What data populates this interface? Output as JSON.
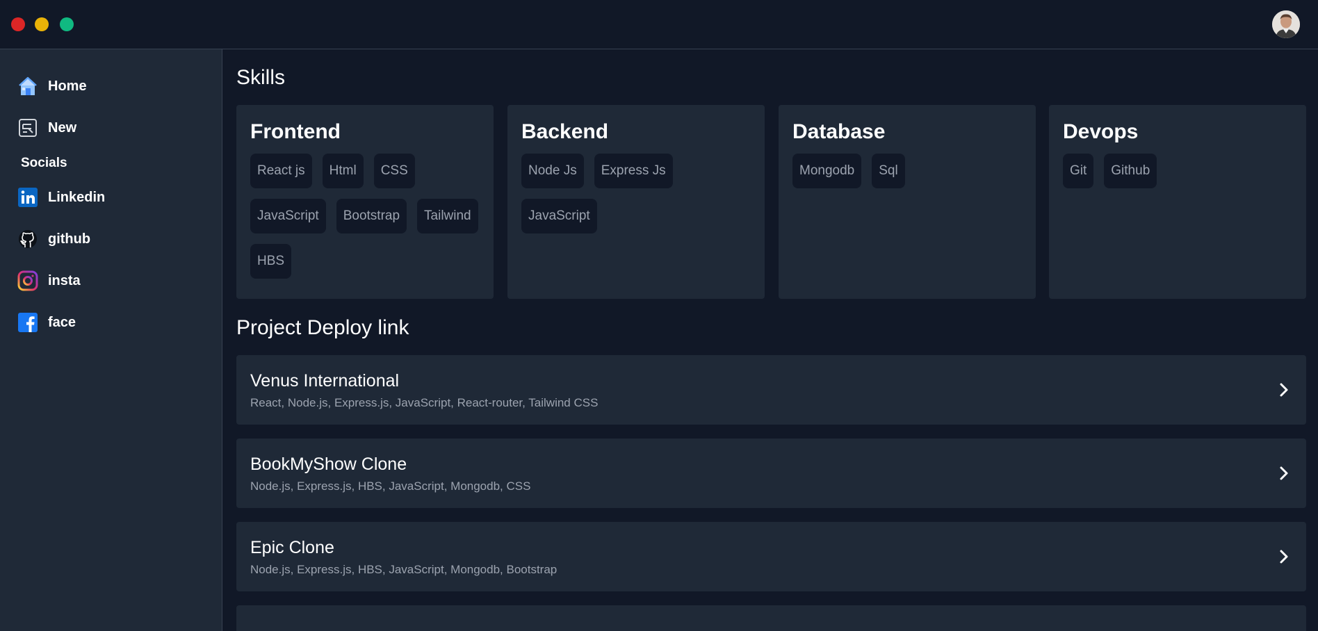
{
  "window": {
    "controls": [
      "close",
      "minimize",
      "maximize"
    ],
    "avatar_icon": "user-avatar"
  },
  "sidebar": {
    "items": [
      {
        "label": "Home",
        "icon": "home-icon"
      },
      {
        "label": "New",
        "icon": "new-post-icon"
      }
    ],
    "socials_label": "Socials",
    "socials": [
      {
        "label": "Linkedin",
        "icon": "linkedin-icon"
      },
      {
        "label": "github",
        "icon": "github-icon"
      },
      {
        "label": "insta",
        "icon": "instagram-icon"
      },
      {
        "label": "face",
        "icon": "facebook-icon"
      }
    ]
  },
  "skills": {
    "heading": "Skills",
    "cards": [
      {
        "title": "Frontend",
        "items": [
          "React js",
          "Html",
          "CSS",
          "JavaScript",
          "Bootstrap",
          "Tailwind",
          "HBS"
        ]
      },
      {
        "title": "Backend",
        "items": [
          "Node Js",
          "Express Js",
          "JavaScript"
        ]
      },
      {
        "title": "Database",
        "items": [
          "Mongodb",
          "Sql"
        ]
      },
      {
        "title": "Devops",
        "items": [
          "Git",
          "Github"
        ]
      }
    ]
  },
  "projects": {
    "heading": "Project Deploy link",
    "items": [
      {
        "name": "Venus International",
        "tech": "React, Node.js, Express.js, JavaScript, React-router, Tailwind CSS"
      },
      {
        "name": "BookMyShow Clone",
        "tech": "Node.js, Express.js, HBS, JavaScript, Mongodb, CSS"
      },
      {
        "name": "Epic Clone",
        "tech": "Node.js, Express.js, HBS, JavaScript, Mongodb, Bootstrap"
      },
      {
        "name": "",
        "tech": ""
      }
    ]
  },
  "colors": {
    "background": "#111827",
    "panel": "#1f2937",
    "chip": "#111827",
    "muted_text": "#9ca3af",
    "close": "#dc2626",
    "minimize": "#eab308",
    "maximize": "#10b981"
  }
}
